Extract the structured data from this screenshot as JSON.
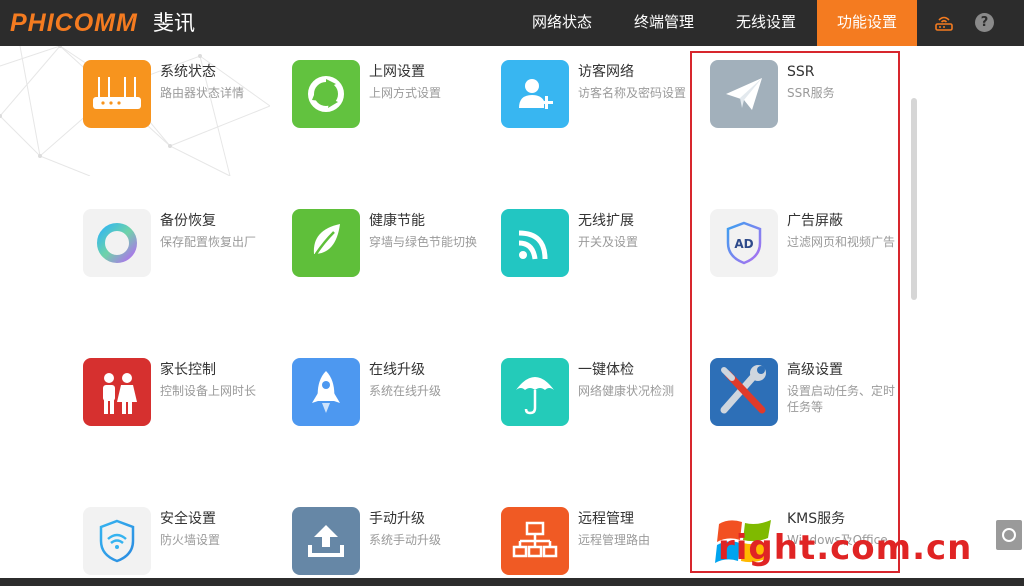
{
  "header": {
    "logo": "PHICOMM",
    "logo_cn": "斐讯",
    "tabs": [
      {
        "label": "网络状态",
        "active": false
      },
      {
        "label": "终端管理",
        "active": false
      },
      {
        "label": "无线设置",
        "active": false
      },
      {
        "label": "功能设置",
        "active": true
      }
    ],
    "icons": [
      "router-icon",
      "help-icon"
    ],
    "help_glyph": "?"
  },
  "features": [
    {
      "title": "系统状态",
      "desc": "路由器状态详情",
      "icon": "router-icon",
      "color": "#f7941e"
    },
    {
      "title": "上网设置",
      "desc": "上网方式设置",
      "icon": "globe-ring-icon",
      "color": "#62c23f"
    },
    {
      "title": "访客网络",
      "desc": "访客名称及密码设置",
      "icon": "guest-user-icon",
      "color": "#38b6f1"
    },
    {
      "title": "SSR",
      "desc": "SSR服务",
      "icon": "paper-plane-icon",
      "color": "#a2b0bb"
    },
    {
      "title": "备份恢复",
      "desc": "保存配置恢复出厂",
      "icon": "backup-ring-icon",
      "color": "#f2f2f2"
    },
    {
      "title": "健康节能",
      "desc": "穿墙与绿色节能切换",
      "icon": "leaf-icon",
      "color": "#5fbf3a"
    },
    {
      "title": "无线扩展",
      "desc": "开关及设置",
      "icon": "wifi-signal-icon",
      "color": "#22c6c2"
    },
    {
      "title": "广告屏蔽",
      "desc": "过滤网页和视频广告",
      "icon": "ad-shield-icon",
      "color": "#f2f2f2",
      "badge": "AD"
    },
    {
      "title": "家长控制",
      "desc": "控制设备上网时长",
      "icon": "family-icon",
      "color": "#d6302f"
    },
    {
      "title": "在线升级",
      "desc": "系统在线升级",
      "icon": "rocket-icon",
      "color": "#4d98f0"
    },
    {
      "title": "一键体检",
      "desc": "网络健康状况检测",
      "icon": "umbrella-icon",
      "color": "#24cbb9"
    },
    {
      "title": "高级设置",
      "desc": "设置启动任务、定时任务等",
      "icon": "tools-icon",
      "color": "#2d6fb7"
    },
    {
      "title": "安全设置",
      "desc": "防火墙设置",
      "icon": "wifi-shield-icon",
      "color": "#f2f2f2"
    },
    {
      "title": "手动升级",
      "desc": "系统手动升级",
      "icon": "upload-icon",
      "color": "#6687a6"
    },
    {
      "title": "远程管理",
      "desc": "远程管理路由",
      "icon": "network-icon",
      "color": "#f05a24"
    },
    {
      "title": "KMS服务",
      "desc": "Windows及Office",
      "icon": "windows-logo-icon",
      "color": "#ffffff"
    }
  ],
  "watermark": "right.com.cn"
}
